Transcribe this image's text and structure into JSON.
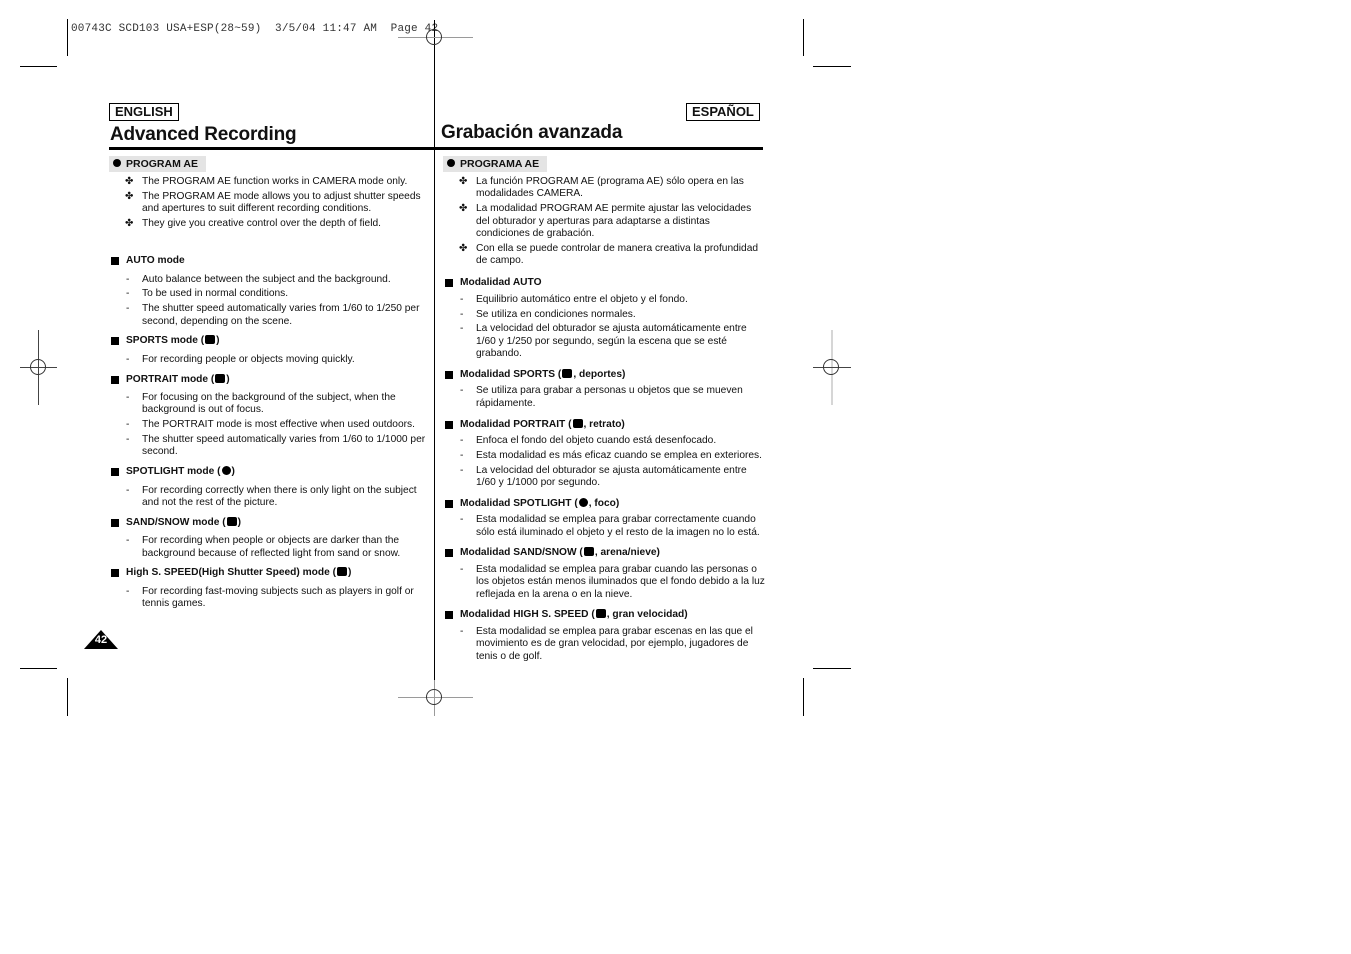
{
  "print_header": {
    "text": "00743C SCD103 USA+ESP(28~59)  3/5/04 11:47 AM  Page 42"
  },
  "page_number": "42",
  "english": {
    "lang_label": "ENGLISH",
    "title": "Advanced Recording",
    "section": "PROGRAM AE",
    "intro": [
      "The PROGRAM AE function works in CAMERA mode only.",
      "The PROGRAM AE mode allows you to adjust shutter speeds and apertures to suit different recording conditions.",
      "They give you creative control over the depth of field."
    ],
    "modes": [
      {
        "heading": "AUTO mode",
        "icon": "",
        "items": [
          "Auto balance between the subject and the background.",
          "To be used in normal conditions.",
          "The shutter speed automatically varies from 1/60 to 1/250 per second, depending on the scene."
        ]
      },
      {
        "heading": "SPORTS mode (",
        "icon": "sports-mode-icon",
        "heading_end": ")",
        "items": [
          "For recording people or objects moving quickly."
        ]
      },
      {
        "heading": "PORTRAIT mode (",
        "icon": "portrait-mode-icon",
        "heading_end": ")",
        "items": [
          "For focusing on the background of the subject, when the background is out of focus.",
          "The PORTRAIT mode is most effective when used outdoors.",
          "The shutter speed automatically varies from 1/60 to 1/1000 per second."
        ]
      },
      {
        "heading": "SPOTLIGHT mode (",
        "icon": "spotlight-mode-icon",
        "heading_end": ")",
        "items": [
          "For recording correctly when there is only light on the subject and not the rest of the picture."
        ]
      },
      {
        "heading": "SAND/SNOW mode (",
        "icon": "sand-snow-mode-icon",
        "heading_end": ")",
        "items": [
          "For recording when people or objects are darker than the background because of reflected light from sand or snow."
        ]
      },
      {
        "heading": "High S. SPEED(High Shutter Speed) mode (",
        "icon": "high-speed-mode-icon",
        "heading_end": ")",
        "items": [
          "For recording fast-moving subjects such as players in golf or tennis games."
        ]
      }
    ]
  },
  "spanish": {
    "lang_label": "ESPAÑOL",
    "title": "Grabación avanzada",
    "section": "PROGRAMA AE",
    "intro": [
      "La función PROGRAM AE (programa AE) sólo opera en las modalidades CAMERA.",
      "La modalidad PROGRAM AE permite ajustar las velocidades del obturador y aperturas para adaptarse a distintas condiciones de grabación.",
      "Con ella se puede controlar de manera creativa la profundidad de campo."
    ],
    "modes": [
      {
        "heading": "Modalidad AUTO",
        "items": [
          "Equilibrio automático entre el objeto y el fondo.",
          "Se utiliza en condiciones normales.",
          "La velocidad del obturador se ajusta automáticamente entre 1/60 y 1/250 por segundo, según la escena que se esté grabando."
        ]
      },
      {
        "heading": "Modalidad SPORTS (",
        "heading_end": ", deportes)",
        "items": [
          "Se utiliza para grabar a personas u objetos que se mueven rápidamente."
        ]
      },
      {
        "heading": "Modalidad PORTRAIT (",
        "heading_end": ", retrato)",
        "items": [
          "Enfoca el fondo del objeto cuando está desenfocado.",
          "Esta modalidad es más eficaz cuando se emplea en exteriores.",
          "La velocidad del obturador se ajusta automáticamente entre 1/60 y 1/1000 por segundo."
        ]
      },
      {
        "heading": "Modalidad SPOTLIGHT (",
        "heading_end": ", foco)",
        "items": [
          "Esta modalidad se emplea para grabar correctamente cuando sólo está iluminado el objeto y el resto de la imagen no lo está."
        ]
      },
      {
        "heading": "Modalidad SAND/SNOW (",
        "heading_end": ", arena/nieve)",
        "items": [
          "Esta modalidad se emplea para grabar cuando las personas o los objetos están menos iluminados que el fondo debido a la luz reflejada en la arena o en la nieve."
        ]
      },
      {
        "heading": "Modalidad HIGH S. SPEED (",
        "heading_end": ", gran velocidad)",
        "items": [
          "Esta modalidad se emplea para grabar escenas en las que el movimiento es de gran velocidad, por ejemplo, jugadores de tenis o de golf."
        ]
      }
    ]
  },
  "markers": {
    "plus": "✤",
    "dash": "-"
  }
}
